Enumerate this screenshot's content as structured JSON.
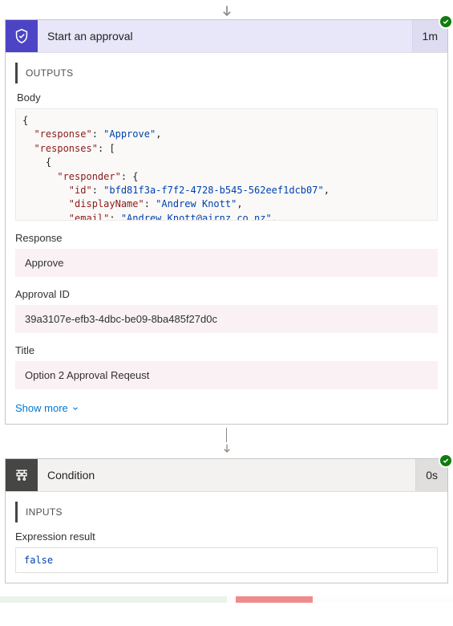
{
  "approval": {
    "title": "Start an approval",
    "duration": "1m",
    "outputs_label": "OUTPUTS",
    "body_label": "Body",
    "json": {
      "l1": "{",
      "l2k": "\"response\"",
      "l2v": "\"Approve\"",
      "l3k": "\"responses\"",
      "l4": "    {",
      "l5k": "\"responder\"",
      "l6k": "\"id\"",
      "l6v": "\"bfd81f3a-f7f2-4728-b545-562eef1dcb07\"",
      "l7k": "\"displayName\"",
      "l7v": "\"Andrew Knott\"",
      "l8k": "\"email\"",
      "l8v": "\"Andrew.Knott@airnz.co.nz\""
    },
    "fields": {
      "response_label": "Response",
      "response_value": "Approve",
      "approval_id_label": "Approval ID",
      "approval_id_value": "39a3107e-efb3-4dbc-be09-8ba485f27d0c",
      "title_label": "Title",
      "title_value": "Option 2 Approval Reqeust"
    },
    "show_more": "Show more"
  },
  "condition": {
    "title": "Condition",
    "duration": "0s",
    "inputs_label": "INPUTS",
    "expr_label": "Expression result",
    "expr_value": "false"
  },
  "chart_data": null
}
